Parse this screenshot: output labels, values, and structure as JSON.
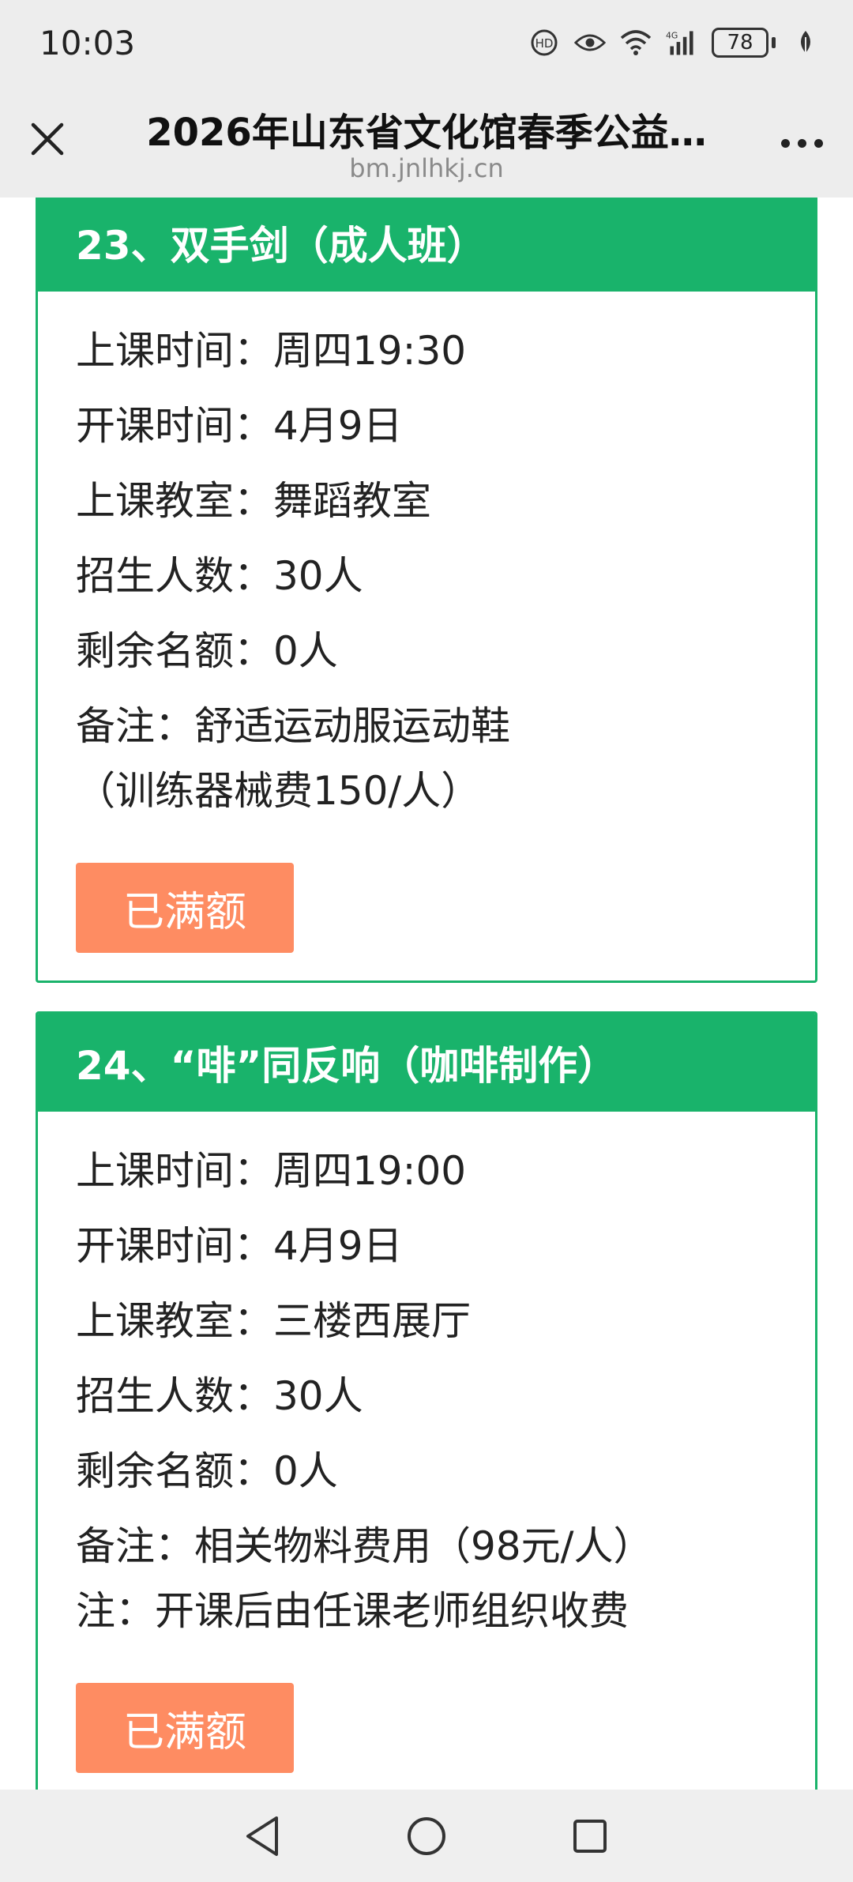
{
  "status_bar": {
    "time": "10:03",
    "battery": "78",
    "icons": [
      "hd-call-icon",
      "eye-icon",
      "wifi-icon",
      "4g-signal-icon",
      "battery-icon",
      "leaf-icon"
    ]
  },
  "title_bar": {
    "title": "2026年山东省文化馆春季公益…",
    "domain": "bm.jnlhkj.cn"
  },
  "courses": [
    {
      "header": "23、双手剑（成人班）",
      "rows": [
        "上课时间：周四19:30",
        "开课时间：4月9日",
        "上课教室：舞蹈教室",
        "招生人数：30人",
        "剩余名额：0人"
      ],
      "note_lines": [
        "备注：舒适运动服运动鞋",
        "（训练器械费150/人）"
      ],
      "button": "已满额"
    },
    {
      "header": "24、“啡”同反响（咖啡制作）",
      "rows": [
        "上课时间：周四19:00",
        "开课时间：4月9日",
        "上课教室：三楼西展厅",
        "招生人数：30人",
        "剩余名额：0人"
      ],
      "note_lines": [
        "备注：相关物料费用（98元/人）",
        "注：开课后由任课老师组织收费"
      ],
      "button": "已满额"
    }
  ],
  "colors": {
    "accent_green": "#19b36b",
    "button_orange": "#fe8c62"
  }
}
